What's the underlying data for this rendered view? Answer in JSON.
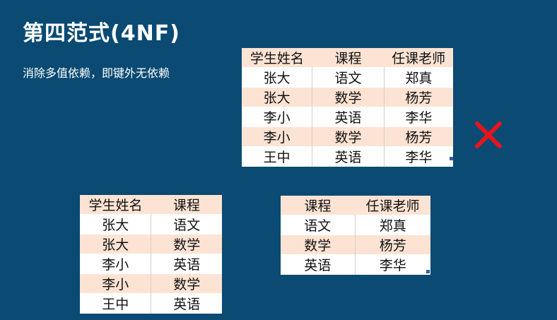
{
  "slide": {
    "title": "第四范式(4NF)",
    "subtitle": "消除多值依赖，即键外无依赖"
  },
  "colors": {
    "background": "#0a4a73",
    "header_fill": "#fde3d3",
    "cross": "#e8141b"
  },
  "table_full": {
    "headers": [
      "学生姓名",
      "课程",
      "任课老师"
    ],
    "rows": [
      [
        "张大",
        "语文",
        "郑真"
      ],
      [
        "张大",
        "数学",
        "杨芳"
      ],
      [
        "李小",
        "英语",
        "李华"
      ],
      [
        "李小",
        "数学",
        "杨芳"
      ],
      [
        "王中",
        "英语",
        "李华"
      ]
    ]
  },
  "table_student_course": {
    "headers": [
      "学生姓名",
      "课程"
    ],
    "rows": [
      [
        "张大",
        "语文"
      ],
      [
        "张大",
        "数学"
      ],
      [
        "李小",
        "英语"
      ],
      [
        "李小",
        "数学"
      ],
      [
        "王中",
        "英语"
      ]
    ]
  },
  "table_course_teacher": {
    "headers": [
      "课程",
      "任课老师"
    ],
    "rows": [
      [
        "语文",
        "郑真"
      ],
      [
        "数学",
        "杨芳"
      ],
      [
        "英语",
        "李华"
      ]
    ]
  },
  "icons": {
    "cross": "cross-icon"
  }
}
